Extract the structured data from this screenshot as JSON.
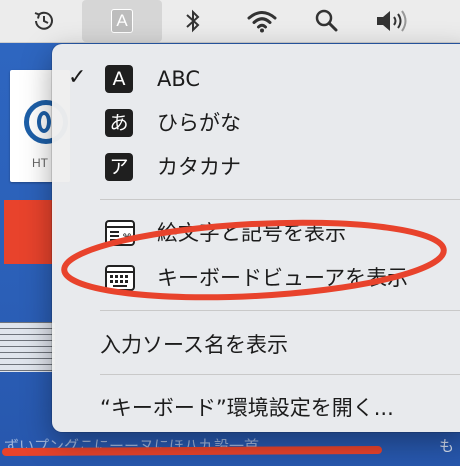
{
  "menubar": {
    "items": [
      {
        "name": "time-machine-icon"
      },
      {
        "name": "input-source-icon",
        "glyph": "A"
      },
      {
        "name": "bluetooth-icon"
      },
      {
        "name": "wifi-icon"
      },
      {
        "name": "search-icon"
      },
      {
        "name": "volume-icon"
      }
    ]
  },
  "desktop": {
    "doc_label": "HT",
    "bottom_text": "ずいプングこにーーヌにほ八九設一首",
    "bottom_right": "も"
  },
  "menu": {
    "sources": [
      {
        "badge": "A",
        "label": "ABC",
        "checked": true
      },
      {
        "badge": "あ",
        "label": "ひらがな",
        "checked": false
      },
      {
        "badge": "ア",
        "label": "カタカナ",
        "checked": false
      }
    ],
    "viewers": [
      {
        "icon": "emoji-symbols-icon",
        "label": "絵文字と記号を表示"
      },
      {
        "icon": "keyboard-icon",
        "label": "キーボードビューアを表示"
      }
    ],
    "show_source_name": "入力ソース名を表示",
    "open_prefs": "“キーボード”環境設定を開く..."
  },
  "colors": {
    "menubar_bg": "#ececec",
    "desktop_blue": "#2e66c0",
    "annotation_red": "#e8432c",
    "badge_bg": "#1f1f1f"
  }
}
